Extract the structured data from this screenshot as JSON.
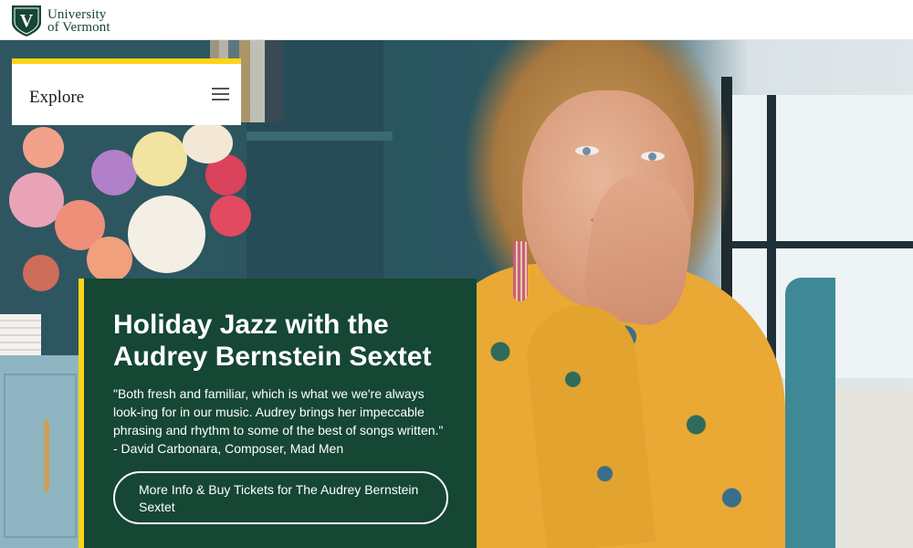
{
  "header": {
    "logo_line1": "University",
    "logo_line2": "of Vermont",
    "shield_letter": "V",
    "brand_green": "#154734"
  },
  "explore": {
    "label": "Explore",
    "menu_icon": "hamburger-menu-icon",
    "accent": "#ffd416"
  },
  "event": {
    "title": "Holiday Jazz with the Audrey Bernstein Sextet",
    "quote": "\"Both fresh and familiar, which is what we we're always look-ing for in our music. Audrey brings her impeccable phrasing and rhythm to some of the best of songs written.\" - David Carbonara, Composer, Mad Men",
    "button_label": "More Info & Buy Tickets for The Audrey Bernstein Sextet"
  }
}
